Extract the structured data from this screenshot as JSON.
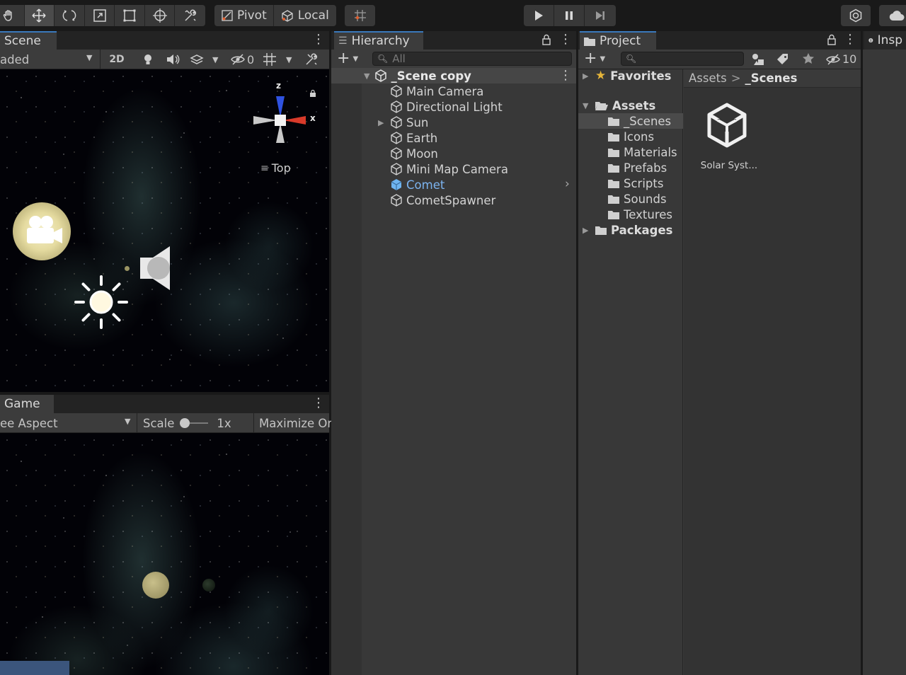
{
  "toolbar": {
    "pivot_label": "Pivot",
    "local_label": "Local"
  },
  "scene": {
    "tab_label": "Scene",
    "shading_mode": "aded",
    "mode_2d": "2D",
    "hidden_count": "0",
    "gizmo": {
      "z_label": "z",
      "x_label": "x",
      "view_label": "Top"
    }
  },
  "game": {
    "tab_label": "Game",
    "aspect": "ee Aspect",
    "scale_label": "Scale",
    "scale_value": "1x",
    "maximize_label": "Maximize On"
  },
  "hierarchy": {
    "tab_label": "Hierarchy",
    "search_placeholder": "All",
    "scene_name": "_Scene copy",
    "items": [
      {
        "label": "Main Camera"
      },
      {
        "label": "Directional Light"
      },
      {
        "label": "Sun"
      },
      {
        "label": "Earth"
      },
      {
        "label": "Moon"
      },
      {
        "label": "Mini Map Camera"
      },
      {
        "label": "Comet"
      },
      {
        "label": "CometSpawner"
      }
    ]
  },
  "project": {
    "tab_label": "Project",
    "hidden_count": "10",
    "favorites_label": "Favorites",
    "assets_label": "Assets",
    "folders": [
      {
        "label": "_Scenes"
      },
      {
        "label": "Icons"
      },
      {
        "label": "Materials"
      },
      {
        "label": "Prefabs"
      },
      {
        "label": "Scripts"
      },
      {
        "label": "Sounds"
      },
      {
        "label": "Textures"
      }
    ],
    "packages_label": "Packages",
    "breadcrumb": {
      "root": "Assets",
      "separator": ">",
      "current": "_Scenes"
    },
    "asset_name": "Solar Syst..."
  },
  "inspector": {
    "tab_label": "Insp"
  },
  "colors": {
    "accent": "#3a79bb",
    "selected_row": "#464646",
    "highlight_text": "#7cb4f0",
    "panel": "#383838",
    "panel_dark": "#232323"
  }
}
